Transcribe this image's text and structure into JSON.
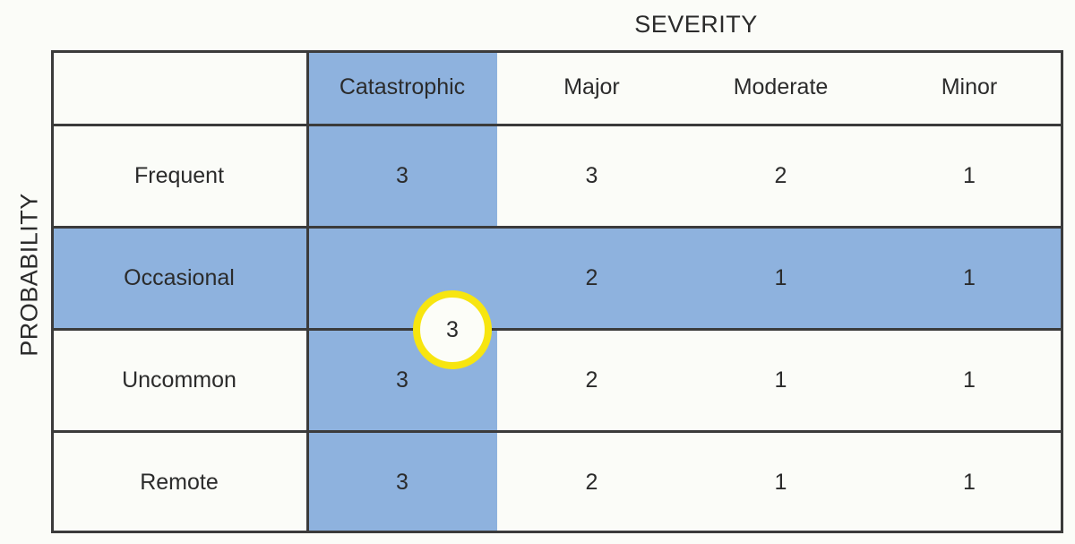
{
  "axes": {
    "severity_label": "SEVERITY",
    "probability_label": "PROBABILITY"
  },
  "colors": {
    "highlight_blue": "#8EB2DE",
    "circle_ring": "#F7E510",
    "circle_fill": "#FCFDF8",
    "grid_line": "#3B3B3B",
    "text": "#2B2B2B",
    "background": "#FBFCF8"
  },
  "highlight": {
    "highlighted_column": "Catastrophic",
    "highlighted_row": "Occasional",
    "circled_cell_value": "3"
  },
  "chart_data": {
    "type": "table",
    "title": "",
    "xlabel": "SEVERITY",
    "ylabel": "PROBABILITY",
    "corner_header": "",
    "categories": [
      "Catastrophic",
      "Major",
      "Moderate",
      "Minor"
    ],
    "row_labels": [
      "Frequent",
      "Occasional",
      "Uncommon",
      "Remote"
    ],
    "rows": [
      {
        "label": "Frequent",
        "values": [
          "3",
          "3",
          "2",
          "1"
        ]
      },
      {
        "label": "Occasional",
        "values": [
          "3",
          "2",
          "1",
          "1"
        ]
      },
      {
        "label": "Uncommon",
        "values": [
          "3",
          "2",
          "1",
          "1"
        ]
      },
      {
        "label": "Remote",
        "values": [
          "3",
          "2",
          "1",
          "1"
        ]
      }
    ],
    "series": [
      {
        "name": "Catastrophic",
        "values": [
          3,
          3,
          3,
          3
        ]
      },
      {
        "name": "Major",
        "values": [
          3,
          2,
          2,
          2
        ]
      },
      {
        "name": "Moderate",
        "values": [
          2,
          1,
          1,
          1
        ]
      },
      {
        "name": "Minor",
        "values": [
          1,
          1,
          1,
          1
        ]
      }
    ],
    "grid": true,
    "legend": "none"
  }
}
